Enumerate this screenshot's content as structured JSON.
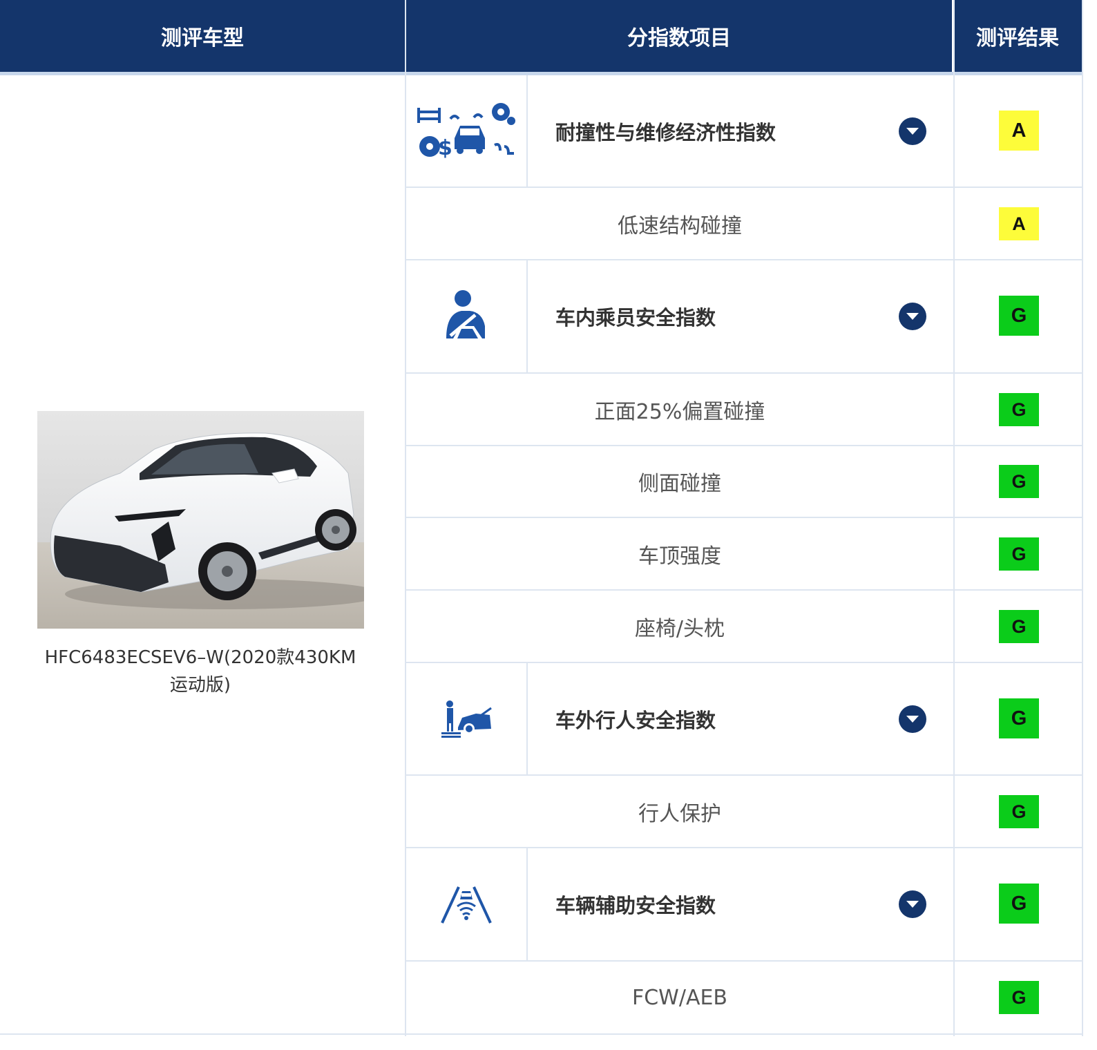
{
  "header": {
    "model": "测评车型",
    "items": "分指数项目",
    "result": "测评结果"
  },
  "vehicle": {
    "name_line1": "HFC6483ECSEV6–W(2020款430KM",
    "name_line2": "运动版)"
  },
  "colors": {
    "header_bg": "#14356b",
    "grade_a": "#fdfc3a",
    "grade_g": "#0bcc1a"
  },
  "rows": [
    {
      "kind": "main",
      "icon": "repair-economy-icon",
      "label": "耐撞性与维修经济性指数",
      "grade": "A"
    },
    {
      "kind": "sub",
      "label": "低速结构碰撞",
      "grade": "A"
    },
    {
      "kind": "main",
      "icon": "occupant-seatbelt-icon",
      "label": "车内乘员安全指数",
      "grade": "G"
    },
    {
      "kind": "sub",
      "label": "正面25%偏置碰撞",
      "grade": "G"
    },
    {
      "kind": "sub",
      "label": "侧面碰撞",
      "grade": "G"
    },
    {
      "kind": "sub",
      "label": "车顶强度",
      "grade": "G"
    },
    {
      "kind": "sub",
      "label": "座椅/头枕",
      "grade": "G"
    },
    {
      "kind": "main",
      "icon": "pedestrian-car-icon",
      "label": "车外行人安全指数",
      "grade": "G"
    },
    {
      "kind": "sub",
      "label": "行人保护",
      "grade": "G"
    },
    {
      "kind": "main",
      "icon": "driver-assist-icon",
      "label": "车辆辅助安全指数",
      "grade": "G"
    },
    {
      "kind": "sub",
      "label": "FCW/AEB",
      "grade": "G"
    }
  ]
}
